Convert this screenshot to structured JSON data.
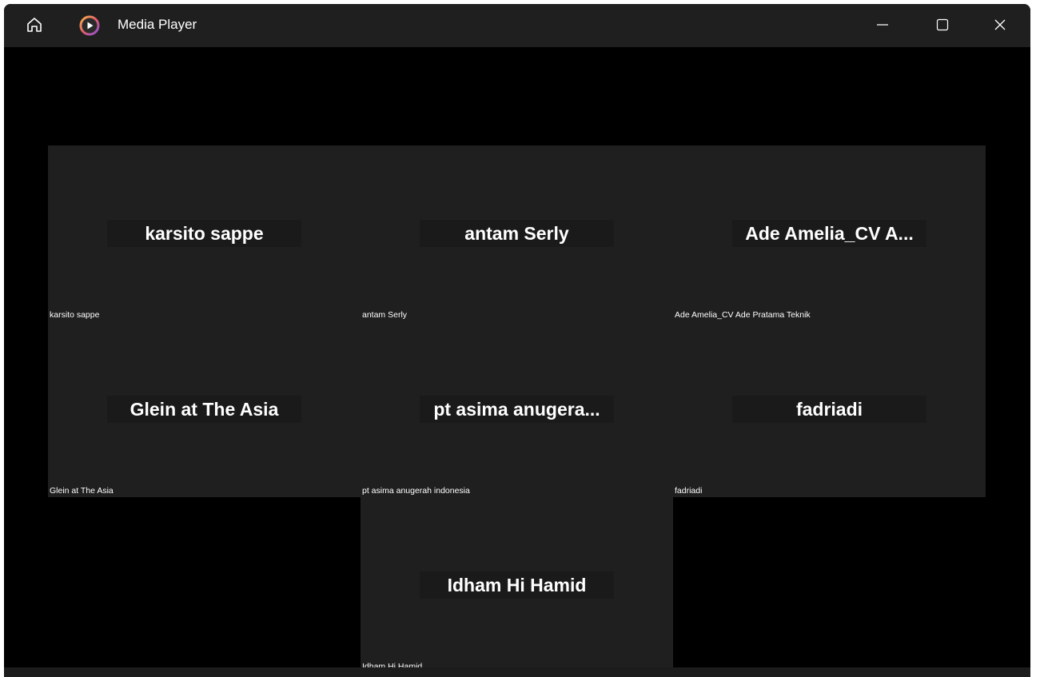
{
  "window": {
    "title": "Media Player",
    "icons": {
      "home": "home-icon",
      "app": "media-player-icon",
      "minimize": "minimize-icon",
      "maximize": "maximize-icon",
      "close": "close-icon"
    }
  },
  "participants": [
    {
      "display_name": "karsito sappe",
      "label": "karsito sappe"
    },
    {
      "display_name": "antam Serly",
      "label": "antam Serly"
    },
    {
      "display_name": "Ade Amelia_CV A...",
      "label": "Ade Amelia_CV Ade Pratama Teknik"
    },
    {
      "display_name": "Glein at The Asia",
      "label": "Glein at The Asia"
    },
    {
      "display_name": "pt asima anugera...",
      "label": "pt asima anugerah indonesia"
    },
    {
      "display_name": "fadriadi",
      "label": "fadriadi"
    },
    {
      "display_name": "Idham Hi Hamid",
      "label": "Idham Hi Hamid"
    }
  ],
  "colors": {
    "background": "#000000",
    "titlebar": "#1f1f1f",
    "tile": "#1f1f1f",
    "text": "#ffffff",
    "accent": "#e8a04a"
  }
}
